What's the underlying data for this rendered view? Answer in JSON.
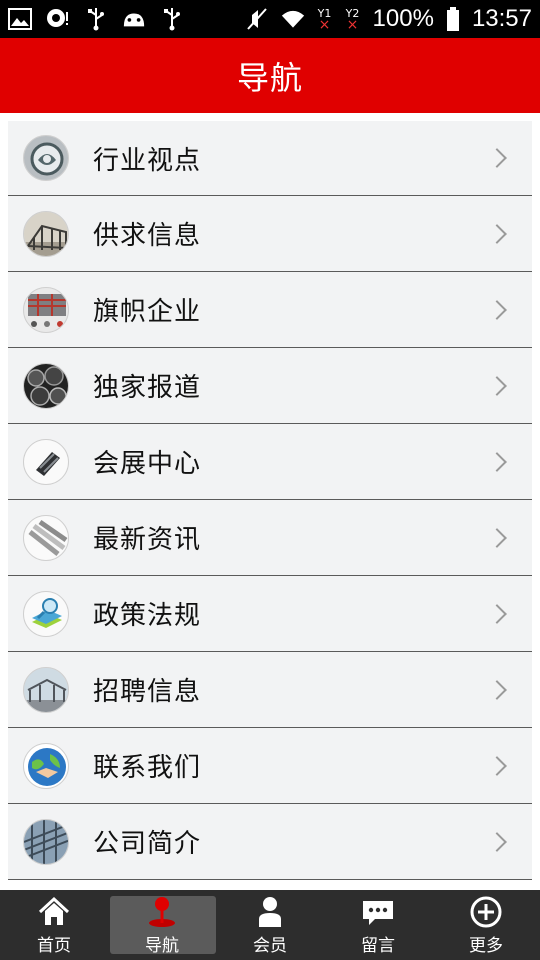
{
  "status_bar": {
    "battery": "100%",
    "time": "13:57",
    "sim1": "1",
    "sim2": "2",
    "icons": [
      "image-icon",
      "chat-bubble-icon",
      "usb-icon",
      "android-icon",
      "usb-icon",
      "mute-vibrate-icon",
      "wifi-icon",
      "sim1-no-signal-icon",
      "sim2-no-signal-icon",
      "battery-icon"
    ]
  },
  "header": {
    "title": "导航"
  },
  "nav": {
    "items": [
      {
        "label": "行业视点",
        "icon": "industry-logo-thumb"
      },
      {
        "label": "供求信息",
        "icon": "steel-structure-thumb"
      },
      {
        "label": "旗帜企业",
        "icon": "factory-thumb"
      },
      {
        "label": "独家报道",
        "icon": "steel-pipes-thumb"
      },
      {
        "label": "会展中心",
        "icon": "steel-beams-thumb"
      },
      {
        "label": "最新资讯",
        "icon": "steel-bars-thumb"
      },
      {
        "label": "政策法规",
        "icon": "book-magnifier-thumb"
      },
      {
        "label": "招聘信息",
        "icon": "building-frame-thumb"
      },
      {
        "label": "联系我们",
        "icon": "globe-handshake-thumb"
      },
      {
        "label": "公司简介",
        "icon": "steel-roof-thumb"
      }
    ]
  },
  "tabbar": {
    "tabs": [
      {
        "label": "首页",
        "icon": "home-icon"
      },
      {
        "label": "导航",
        "icon": "map-pin-icon",
        "active": true
      },
      {
        "label": "会员",
        "icon": "user-icon"
      },
      {
        "label": "留言",
        "icon": "message-icon"
      },
      {
        "label": "更多",
        "icon": "plus-circle-icon"
      }
    ]
  },
  "colors": {
    "header_bg": "#e00000",
    "list_bg": "#f2f3f4",
    "tabbar_bg": "#2d2d2d",
    "tab_active_bg": "#5b5b5b"
  }
}
